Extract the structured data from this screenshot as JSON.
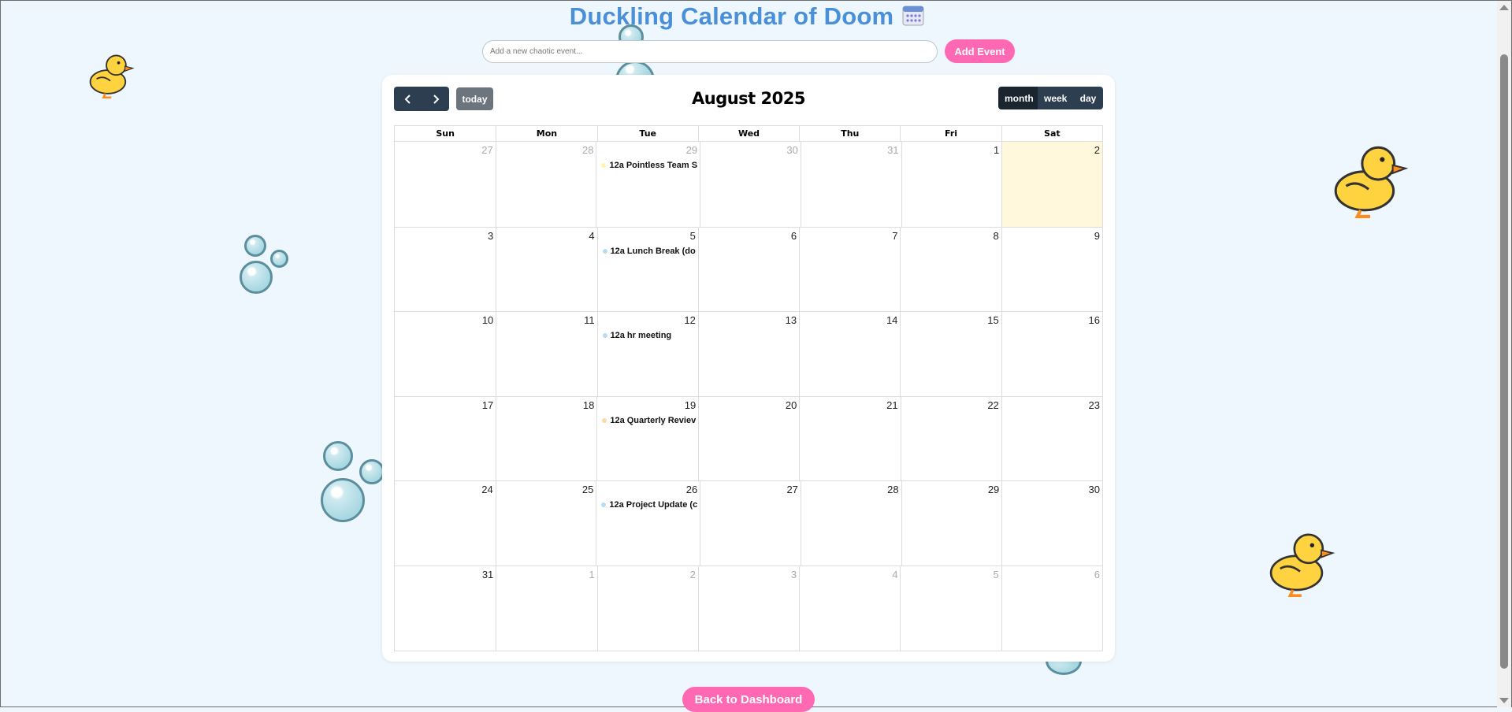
{
  "header": {
    "title": "Duckling Calendar of Doom",
    "title_icon": "calendar-icon"
  },
  "add_event": {
    "placeholder": "Add a new chaotic event...",
    "button_label": "Add Event"
  },
  "calendar": {
    "title": "August 2025",
    "today_label": "today",
    "prev_icon": "chevron-left-icon",
    "next_icon": "chevron-right-icon",
    "views": {
      "month": "month",
      "week": "week",
      "day": "day"
    },
    "active_view": "month",
    "days_of_week": [
      "Sun",
      "Mon",
      "Tue",
      "Wed",
      "Thu",
      "Fri",
      "Sat"
    ],
    "weeks": [
      [
        {
          "num": "27",
          "other": true
        },
        {
          "num": "28",
          "other": true
        },
        {
          "num": "29",
          "other": true,
          "events": [
            {
              "time": "12a",
              "title": "Pointless Team S",
              "color": "#fff5b0"
            }
          ]
        },
        {
          "num": "30",
          "other": true
        },
        {
          "num": "31",
          "other": true
        },
        {
          "num": "1"
        },
        {
          "num": "2",
          "today": true
        }
      ],
      [
        {
          "num": "3"
        },
        {
          "num": "4"
        },
        {
          "num": "5",
          "events": [
            {
              "time": "12a",
              "title": "Lunch Break (do",
              "color": "#b8dcf0"
            }
          ]
        },
        {
          "num": "6"
        },
        {
          "num": "7"
        },
        {
          "num": "8"
        },
        {
          "num": "9"
        }
      ],
      [
        {
          "num": "10"
        },
        {
          "num": "11"
        },
        {
          "num": "12",
          "events": [
            {
              "time": "12a",
              "title": "hr meeting",
              "color": "#b8dcf0"
            }
          ]
        },
        {
          "num": "13"
        },
        {
          "num": "14"
        },
        {
          "num": "15"
        },
        {
          "num": "16"
        }
      ],
      [
        {
          "num": "17"
        },
        {
          "num": "18"
        },
        {
          "num": "19",
          "events": [
            {
              "time": "12a",
              "title": "Quarterly Reviev",
              "color": "#ffd9a8"
            }
          ]
        },
        {
          "num": "20"
        },
        {
          "num": "21"
        },
        {
          "num": "22"
        },
        {
          "num": "23"
        }
      ],
      [
        {
          "num": "24"
        },
        {
          "num": "25"
        },
        {
          "num": "26",
          "events": [
            {
              "time": "12a",
              "title": "Project Update (c",
              "color": "#b8dcf0"
            }
          ]
        },
        {
          "num": "27"
        },
        {
          "num": "28"
        },
        {
          "num": "29"
        },
        {
          "num": "30"
        }
      ],
      [
        {
          "num": "31"
        },
        {
          "num": "1",
          "other": true
        },
        {
          "num": "2",
          "other": true
        },
        {
          "num": "3",
          "other": true
        },
        {
          "num": "4",
          "other": true
        },
        {
          "num": "5",
          "other": true
        },
        {
          "num": "6",
          "other": true
        }
      ]
    ]
  },
  "footer": {
    "back_label": "Back to Dashboard"
  },
  "colors": {
    "background": "#eef6fe",
    "title": "#4a90d9",
    "pink_button": "#ff69b4",
    "dark_button": "#2c3e50",
    "today_bg": "#fff8dc"
  }
}
